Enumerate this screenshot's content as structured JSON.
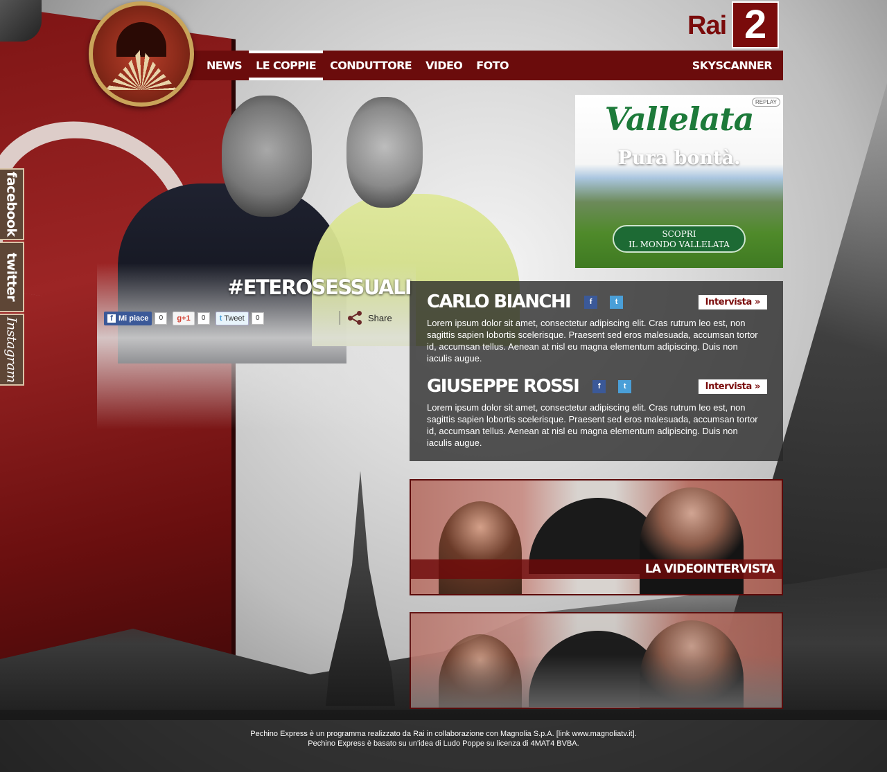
{
  "header": {
    "channel_logo": {
      "text": "Rai",
      "number": "2"
    },
    "nav": [
      {
        "label": "NEWS",
        "active": false
      },
      {
        "label": "LE COPPIE",
        "active": true
      },
      {
        "label": "CONDUTTORE",
        "active": false
      },
      {
        "label": "VIDEO",
        "active": false
      },
      {
        "label": "FOTO",
        "active": false
      }
    ],
    "nav_right": "SKYSCANNER"
  },
  "side_social": [
    "facebook",
    "twitter",
    "Instagram"
  ],
  "couple": {
    "title": "#ETEROSESSUALI",
    "social": {
      "facebook_label": "Mi piace",
      "facebook_count": "0",
      "gplus_label": "+1",
      "gplus_count": "0",
      "twitter_label": "Tweet",
      "twitter_count": "0",
      "share_label": "Share"
    }
  },
  "ad": {
    "replay": "REPLAY",
    "brand": "Vallelata",
    "tagline": "Pura bontà.",
    "cta_line1": "SCOPRI",
    "cta_line2": "IL MONDO VALLELATA"
  },
  "members": [
    {
      "name": "CARLO BIANCHI",
      "button": "Intervista »",
      "text": "Lorem ipsum dolor sit amet, consectetur adipiscing elit. Cras rutrum leo est, non sagittis sapien lobortis scelerisque. Praesent sed eros malesuada, accumsan tortor id, accumsan tellus. Aenean at nisl eu magna elementum adipiscing. Duis non iaculis augue."
    },
    {
      "name": "GIUSEPPE ROSSI",
      "button": "Intervista »",
      "text": "Lorem ipsum dolor sit amet, consectetur adipiscing elit. Cras rutrum leo est, non sagittis sapien lobortis scelerisque. Praesent sed eros malesuada, accumsan tortor id, accumsan tellus. Aenean at nisl eu magna elementum adipiscing. Duis non iaculis augue."
    }
  ],
  "video": {
    "label": "LA VIDEOINTERVISTA"
  },
  "footer": {
    "line1": "Pechino Express è un programma realizzato da Rai in collaborazione con Magnolia S.p.A. [link www.magnoliatv.it].",
    "line2": "Pechino Express è basato su un'idea di Ludo Poppe su licenza di 4MAT4 BVBA."
  },
  "colors": {
    "brand_red": "#6b0c0c",
    "rai_red": "#7a0b0b",
    "facebook": "#3b5998",
    "twitter": "#4a9fd8"
  }
}
